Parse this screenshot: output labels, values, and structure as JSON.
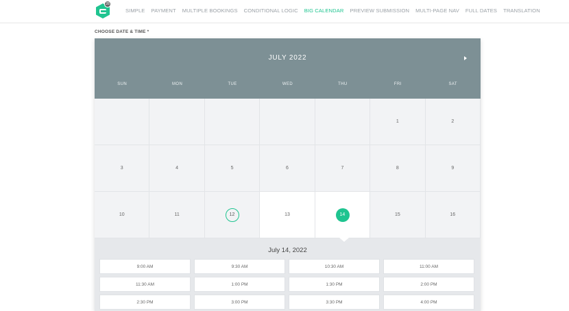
{
  "logo": {
    "badge": "28",
    "icon": "gravity-forms-icon"
  },
  "nav": [
    {
      "label": "SIMPLE",
      "active": false
    },
    {
      "label": "PAYMENT",
      "active": false
    },
    {
      "label": "MULTIPLE BOOKINGS",
      "active": false
    },
    {
      "label": "CONDITIONAL LOGIC",
      "active": false
    },
    {
      "label": "BIG CALENDAR",
      "active": true
    },
    {
      "label": "PREVIEW SUBMISSION",
      "active": false
    },
    {
      "label": "MULTI-PAGE NAV",
      "active": false
    },
    {
      "label": "FULL DATES",
      "active": false
    },
    {
      "label": "TRANSLATION",
      "active": false
    }
  ],
  "field": {
    "label": "CHOOSE DATE & TIME",
    "required_mark": "*"
  },
  "calendar": {
    "month_title": "JULY 2022",
    "next_icon": "caret-right-icon",
    "weekdays": [
      "SUN",
      "MON",
      "TUE",
      "WED",
      "THU",
      "FRI",
      "SAT"
    ],
    "weeks": [
      [
        "",
        "",
        "",
        "",
        "",
        "1",
        "2"
      ],
      [
        "3",
        "4",
        "5",
        "6",
        "7",
        "8",
        "9"
      ],
      [
        "10",
        "11",
        "12",
        "13",
        "14",
        "15",
        "16"
      ]
    ],
    "today": "12",
    "selected": "14",
    "available": [
      "13",
      "14"
    ]
  },
  "times": {
    "date_label": "July 14, 2022",
    "slots": [
      "9:00 AM",
      "9:30 AM",
      "10:30 AM",
      "11:00 AM",
      "11:30 AM",
      "1:00 PM",
      "1:30 PM",
      "2:00 PM",
      "2:30 PM",
      "3:00 PM",
      "3:30 PM",
      "4:00 PM"
    ]
  },
  "colors": {
    "accent": "#1fc490",
    "header": "#7d9095"
  }
}
